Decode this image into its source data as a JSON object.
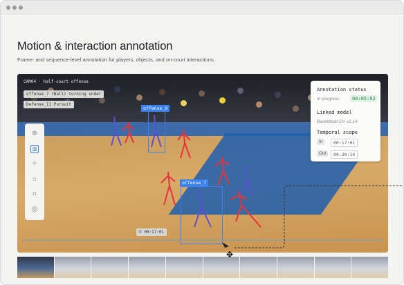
{
  "page": {
    "title": "Motion & interaction annotation",
    "subtitle": "Frame- and sequence-level annotation for players, objects, and on-court interactions."
  },
  "viewer": {
    "camera_label": "CAM04 · half-court offense",
    "tags": [
      "offense_7 (Ball) turning under",
      "Defense_11 Pursuit"
    ],
    "time_chip": "00:17:01",
    "boxes": [
      {
        "label": "offense_9"
      },
      {
        "label": "offense_7"
      }
    ],
    "tools": [
      {
        "name": "add-icon",
        "glyph": "⊕"
      },
      {
        "name": "bounding-box-icon",
        "glyph": "⧈",
        "active": true
      },
      {
        "name": "keypoint-icon",
        "glyph": "✧"
      },
      {
        "name": "tag-icon",
        "glyph": "⌂"
      },
      {
        "name": "track-icon",
        "glyph": "⌗"
      },
      {
        "name": "person-icon",
        "glyph": "◎"
      }
    ]
  },
  "status_panel": {
    "title": "Annotation status",
    "state": "In progress",
    "elapsed": "00:05:02",
    "model_label": "Linked model",
    "model": "Basketball-CV v2.14",
    "scope_label": "Temporal scope",
    "in_label": "In",
    "in_time": "00:17:01",
    "out_label": "Out",
    "out_time": "00:20:14"
  },
  "filmstrip": {
    "frames": 10,
    "selected": 0
  },
  "colors": {
    "accent": "#3c82ee",
    "status_green": "#2a8a45",
    "pose": "#e8323a",
    "pose_alt": "#5a4fd6"
  }
}
